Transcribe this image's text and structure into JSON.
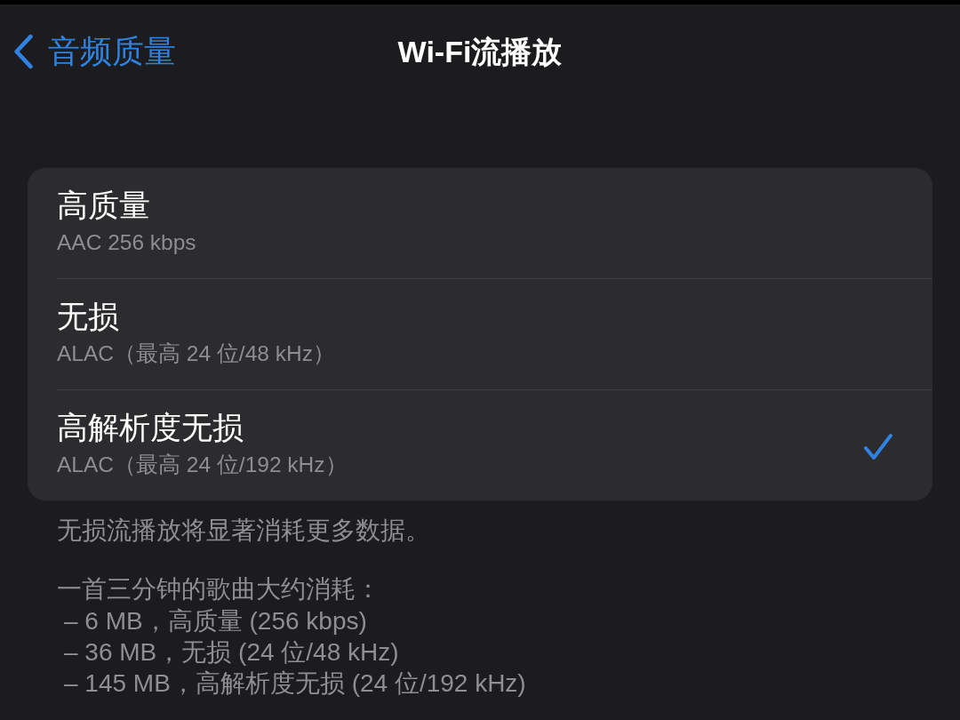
{
  "nav": {
    "back_label": "音频质量",
    "title": "Wi-Fi流播放"
  },
  "options": [
    {
      "title": "高质量",
      "subtitle": "AAC 256 kbps",
      "selected": false
    },
    {
      "title": "无损",
      "subtitle": "ALAC（最高 24 位/48 kHz）",
      "selected": false
    },
    {
      "title": "高解析度无损",
      "subtitle": "ALAC（最高 24 位/192 kHz）",
      "selected": true
    }
  ],
  "footer": {
    "note": "无损流播放将显著消耗更多数据。",
    "usage_heading": "一首三分钟的歌曲大约消耗：",
    "usage_items": [
      "– 6 MB，高质量 (256 kbps)",
      "– 36 MB，无损 (24 位/48 kHz)",
      "– 145 MB，高解析度无损 (24 位/192 kHz)"
    ]
  }
}
